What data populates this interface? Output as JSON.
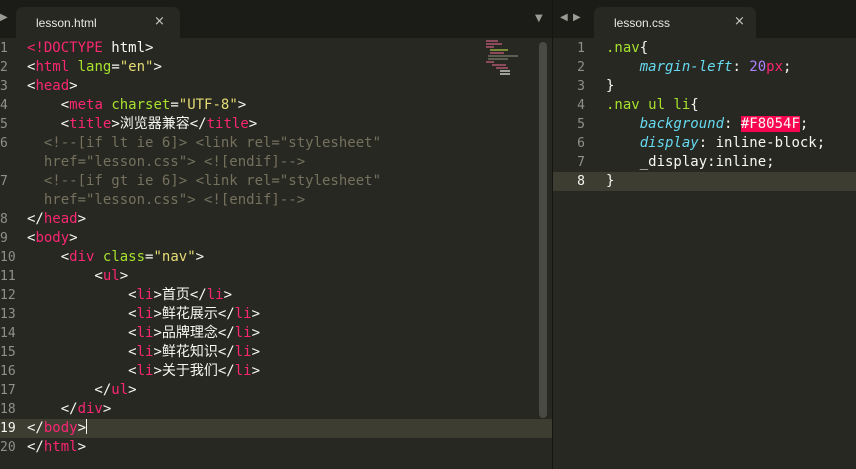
{
  "left_tab": {
    "name": "lesson.html",
    "close": "×"
  },
  "right_tab": {
    "name": "lesson.css",
    "close": "×"
  },
  "ui": {
    "tab_arrow_left": "▶",
    "dropdown_arrow": "▼",
    "nav_prev": "◀",
    "nav_next": "▶"
  },
  "colors": {
    "background": "#272822",
    "tag": "#f92672",
    "attribute": "#a6e22e",
    "string": "#e6db74",
    "comment": "#75715e",
    "property": "#66d9ef",
    "number": "#ae81ff",
    "color_highlight": "#F8054F"
  },
  "html_lines": [
    {
      "num": "1",
      "t": [
        [
          "<!DOCTYPE",
          "t"
        ],
        [
          " html>",
          ""
        ]
      ]
    },
    {
      "num": "2",
      "t": [
        [
          "<",
          ""
        ],
        [
          "html",
          "t"
        ],
        [
          " ",
          ""
        ],
        [
          "lang",
          "a"
        ],
        [
          "=",
          ""
        ],
        [
          "\"en\"",
          "s"
        ],
        [
          ">",
          ""
        ]
      ]
    },
    {
      "num": "3",
      "t": [
        [
          "<",
          ""
        ],
        [
          "head",
          "t"
        ],
        [
          ">",
          ""
        ]
      ]
    },
    {
      "num": "4",
      "t": [
        [
          "    <",
          ""
        ],
        [
          "meta",
          "t"
        ],
        [
          " ",
          ""
        ],
        [
          "charset",
          "a"
        ],
        [
          "=",
          ""
        ],
        [
          "\"UTF-8\"",
          "s"
        ],
        [
          ">",
          ""
        ]
      ]
    },
    {
      "num": "5",
      "t": [
        [
          "    <",
          ""
        ],
        [
          "title",
          "t"
        ],
        [
          ">浏览器兼容</",
          ""
        ],
        [
          "title",
          "t"
        ],
        [
          ">",
          ""
        ]
      ]
    },
    {
      "num": "6",
      "t": [
        [
          "  <!--[if lt ie 6]> <link rel=\"stylesheet\"",
          "c"
        ]
      ]
    },
    {
      "num": "",
      "t": [
        [
          "  href=\"lesson.css\"> <![endif]-->",
          "c"
        ]
      ]
    },
    {
      "num": "7",
      "t": [
        [
          "  <!--[if gt ie 6]> <link rel=\"stylesheet\"",
          "c"
        ]
      ]
    },
    {
      "num": "",
      "t": [
        [
          "  href=\"lesson.css\"> <![endif]-->",
          "c"
        ]
      ]
    },
    {
      "num": "8",
      "t": [
        [
          "</",
          ""
        ],
        [
          "head",
          "t"
        ],
        [
          ">",
          ""
        ]
      ]
    },
    {
      "num": "9",
      "t": [
        [
          "<",
          ""
        ],
        [
          "body",
          "t"
        ],
        [
          ">",
          ""
        ]
      ]
    },
    {
      "num": "10",
      "t": [
        [
          "    <",
          ""
        ],
        [
          "div",
          "t"
        ],
        [
          " ",
          ""
        ],
        [
          "class",
          "a"
        ],
        [
          "=",
          ""
        ],
        [
          "\"nav\"",
          "s"
        ],
        [
          ">",
          ""
        ]
      ]
    },
    {
      "num": "11",
      "t": [
        [
          "        <",
          ""
        ],
        [
          "ul",
          "t"
        ],
        [
          ">",
          ""
        ]
      ]
    },
    {
      "num": "12",
      "t": [
        [
          "            <",
          ""
        ],
        [
          "li",
          "t"
        ],
        [
          ">首页</",
          ""
        ],
        [
          "li",
          "t"
        ],
        [
          ">",
          ""
        ]
      ]
    },
    {
      "num": "13",
      "t": [
        [
          "            <",
          ""
        ],
        [
          "li",
          "t"
        ],
        [
          ">鲜花展示</",
          ""
        ],
        [
          "li",
          "t"
        ],
        [
          ">",
          ""
        ]
      ]
    },
    {
      "num": "14",
      "t": [
        [
          "            <",
          ""
        ],
        [
          "li",
          "t"
        ],
        [
          ">品牌理念</",
          ""
        ],
        [
          "li",
          "t"
        ],
        [
          ">",
          ""
        ]
      ]
    },
    {
      "num": "15",
      "t": [
        [
          "            <",
          ""
        ],
        [
          "li",
          "t"
        ],
        [
          ">鲜花知识</",
          ""
        ],
        [
          "li",
          "t"
        ],
        [
          ">",
          ""
        ]
      ]
    },
    {
      "num": "16",
      "t": [
        [
          "            <",
          ""
        ],
        [
          "li",
          "t"
        ],
        [
          ">关于我们</",
          ""
        ],
        [
          "li",
          "t"
        ],
        [
          ">",
          ""
        ]
      ]
    },
    {
      "num": "17",
      "t": [
        [
          "        </",
          ""
        ],
        [
          "ul",
          "t"
        ],
        [
          ">",
          ""
        ]
      ]
    },
    {
      "num": "18",
      "t": [
        [
          "    </",
          ""
        ],
        [
          "div",
          "t"
        ],
        [
          ">",
          ""
        ]
      ]
    },
    {
      "num": "19",
      "current": true,
      "t": [
        [
          "</",
          ""
        ],
        [
          "body",
          "t"
        ],
        [
          ">",
          ""
        ],
        [
          "",
          "cursor"
        ]
      ]
    },
    {
      "num": "20",
      "t": [
        [
          "</",
          ""
        ],
        [
          "html",
          "t"
        ],
        [
          ">",
          ""
        ]
      ]
    }
  ],
  "css_lines": [
    {
      "num": "1",
      "t": [
        [
          ".nav",
          "sel"
        ],
        [
          "{",
          ""
        ]
      ]
    },
    {
      "num": "2",
      "t": [
        [
          "    ",
          ""
        ],
        [
          "margin-left",
          "prop"
        ],
        [
          ": ",
          ""
        ],
        [
          "20",
          "num"
        ],
        [
          "px",
          "t"
        ],
        [
          ";",
          ""
        ]
      ]
    },
    {
      "num": "3",
      "t": [
        [
          "}",
          ""
        ]
      ]
    },
    {
      "num": "4",
      "t": [
        [
          ".nav ul li",
          "sel"
        ],
        [
          "{",
          ""
        ]
      ]
    },
    {
      "num": "5",
      "t": [
        [
          "    ",
          ""
        ],
        [
          "background",
          "prop"
        ],
        [
          ": ",
          ""
        ],
        [
          "#F8054F",
          "hl"
        ],
        [
          ";",
          ""
        ]
      ]
    },
    {
      "num": "6",
      "t": [
        [
          "    ",
          ""
        ],
        [
          "display",
          "prop"
        ],
        [
          ": ",
          ""
        ],
        [
          "inline-block",
          ""
        ],
        [
          ";",
          ""
        ]
      ]
    },
    {
      "num": "7",
      "t": [
        [
          "    _display:inline;",
          ""
        ]
      ]
    },
    {
      "num": "8",
      "current": true,
      "t": [
        [
          "}",
          ""
        ]
      ]
    }
  ]
}
